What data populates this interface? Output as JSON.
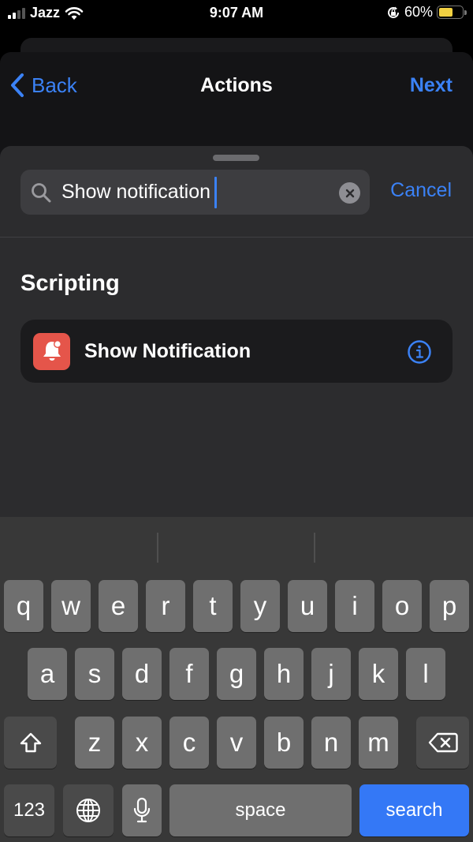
{
  "status_bar": {
    "carrier": "Jazz",
    "time": "9:07 AM",
    "battery_percent_label": "60%",
    "battery_level": 0.6,
    "icons": [
      "signal-icon",
      "wifi-icon",
      "orientation-lock-icon",
      "battery-icon"
    ]
  },
  "nav": {
    "back_label": "Back",
    "title": "Actions",
    "next_label": "Next"
  },
  "search": {
    "value": "Show notification",
    "cancel_label": "Cancel"
  },
  "results": {
    "section_title": "Scripting",
    "items": [
      {
        "label": "Show Notification",
        "icon": "bell-badge-icon",
        "icon_color": "#e5554a"
      }
    ]
  },
  "keyboard": {
    "row1": [
      "q",
      "w",
      "e",
      "r",
      "t",
      "y",
      "u",
      "i",
      "o",
      "p"
    ],
    "row2": [
      "a",
      "s",
      "d",
      "f",
      "g",
      "h",
      "j",
      "k",
      "l"
    ],
    "row3": [
      "z",
      "x",
      "c",
      "v",
      "b",
      "n",
      "m"
    ],
    "numbers_label": "123",
    "space_label": "space",
    "return_label": "search",
    "return_color": "#3478f6"
  },
  "colors": {
    "accent": "#3b82f6",
    "sheet_bg": "#2c2c2e",
    "keyboard_bg": "#383838"
  }
}
